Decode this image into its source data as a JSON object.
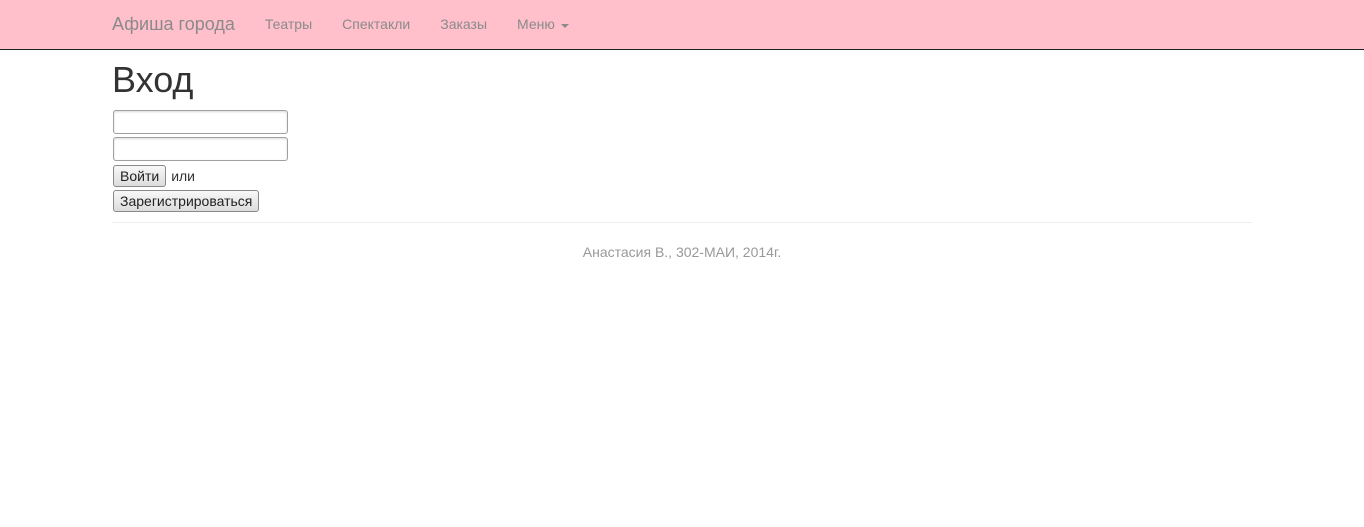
{
  "navbar": {
    "brand": "Афиша города",
    "items": [
      {
        "label": "Театры"
      },
      {
        "label": "Спектакли"
      },
      {
        "label": "Заказы"
      },
      {
        "label": "Меню"
      }
    ],
    "background_color": "#ffc0cb"
  },
  "login": {
    "title": "Вход",
    "login_field": {
      "value": "",
      "placeholder": ""
    },
    "password_field": {
      "value": "",
      "placeholder": ""
    },
    "submit_label": "Войти",
    "or_text": "или",
    "register_label": "Зарегистрироваться"
  },
  "footer": {
    "text": "Анастасия В., 302-МАИ, 2014г."
  }
}
